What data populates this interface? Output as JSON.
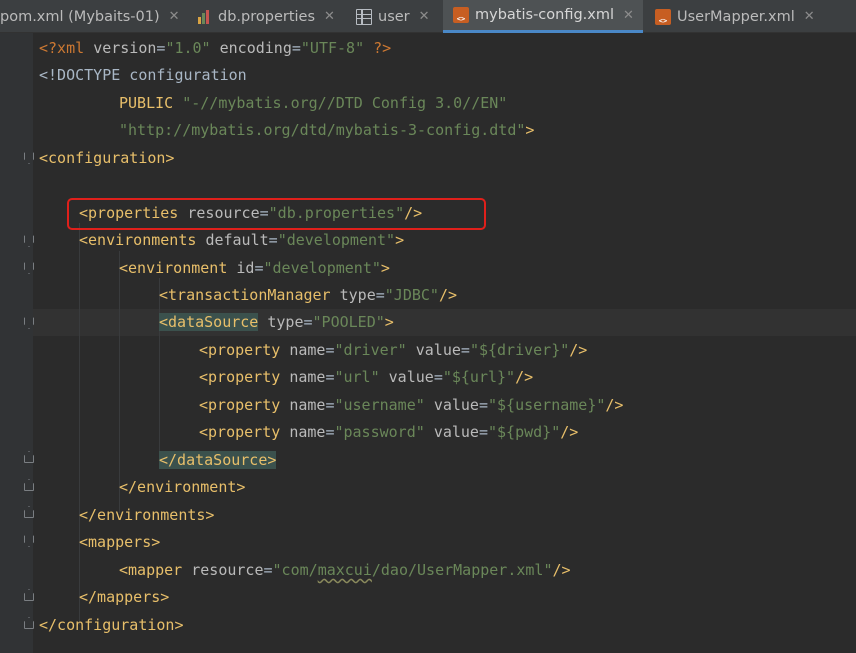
{
  "tabs": [
    {
      "label": "pom.xml (Mybaits-01)",
      "icon": "maven-icon",
      "active": false
    },
    {
      "label": "db.properties",
      "icon": "properties-file-icon",
      "active": false
    },
    {
      "label": "user",
      "icon": "table-icon",
      "active": false
    },
    {
      "label": "mybatis-config.xml",
      "icon": "xml-file-icon",
      "active": true
    },
    {
      "label": "UserMapper.xml",
      "icon": "xml-file-icon",
      "active": false
    }
  ],
  "close_glyph": "✕",
  "code": {
    "xml_decl": {
      "open": "<?xml ",
      "a1": "version",
      "v1": "\"1.0\"",
      "a2": "encoding",
      "v2": "\"UTF-8\"",
      "close": " ?>"
    },
    "doctype": "<!DOCTYPE configuration",
    "public_kw": "PUBLIC ",
    "public_id": "\"-//mybatis.org//DTD Config 3.0//EN\"",
    "dtd_url": "\"http://mybatis.org/dtd/mybatis-3-config.dtd\"",
    "dtd_close": ">",
    "configuration_open": "<configuration>",
    "properties": {
      "tag": "<properties ",
      "attr": "resource",
      "val": "\"db.properties\"",
      "close": "/>"
    },
    "environments": {
      "tag": "<environments ",
      "attr": "default",
      "val": "\"development\"",
      "close": ">"
    },
    "environment": {
      "tag": "<environment ",
      "attr": "id",
      "val": "\"development\"",
      "close": ">"
    },
    "transaction": {
      "tag": "<transactionManager ",
      "attr": "type",
      "val": "\"JDBC\"",
      "close": "/>"
    },
    "datasource": {
      "tag": "<dataSource",
      "sp": " ",
      "attr": "type",
      "val": "\"POOLED\"",
      "close": ">"
    },
    "props": [
      {
        "tag": "<property ",
        "a1": "name",
        "v1": "\"driver\"",
        "a2": "value",
        "v2": "\"${driver}\"",
        "close": "/>"
      },
      {
        "tag": "<property ",
        "a1": "name",
        "v1": "\"url\"",
        "a2": "value",
        "v2": "\"${url}\"",
        "close": "/>"
      },
      {
        "tag": "<property ",
        "a1": "name",
        "v1": "\"username\"",
        "a2": "value",
        "v2": "\"${username}\"",
        "close": "/>"
      },
      {
        "tag": "<property ",
        "a1": "name",
        "v1": "\"password\"",
        "a2": "value",
        "v2": "\"${pwd}\"",
        "close": "/>"
      }
    ],
    "datasource_close": "</dataSource>",
    "environment_close": "</environment>",
    "environments_close": "</environments>",
    "mappers_open": "<mappers>",
    "mapper": {
      "tag": "<mapper ",
      "attr": "resource",
      "v_pre": "\"com/",
      "v_squig": "maxcui",
      "v_post": "/dao/UserMapper.xml\"",
      "close": "/>"
    },
    "mappers_close": "</mappers>",
    "configuration_close": "</configuration>"
  },
  "colors": {
    "tag": "#e8bf6a",
    "attr": "#bababa",
    "value": "#6a8759",
    "background": "#2b2b2b",
    "gutter": "#313335",
    "highlight": "#e0201b"
  }
}
